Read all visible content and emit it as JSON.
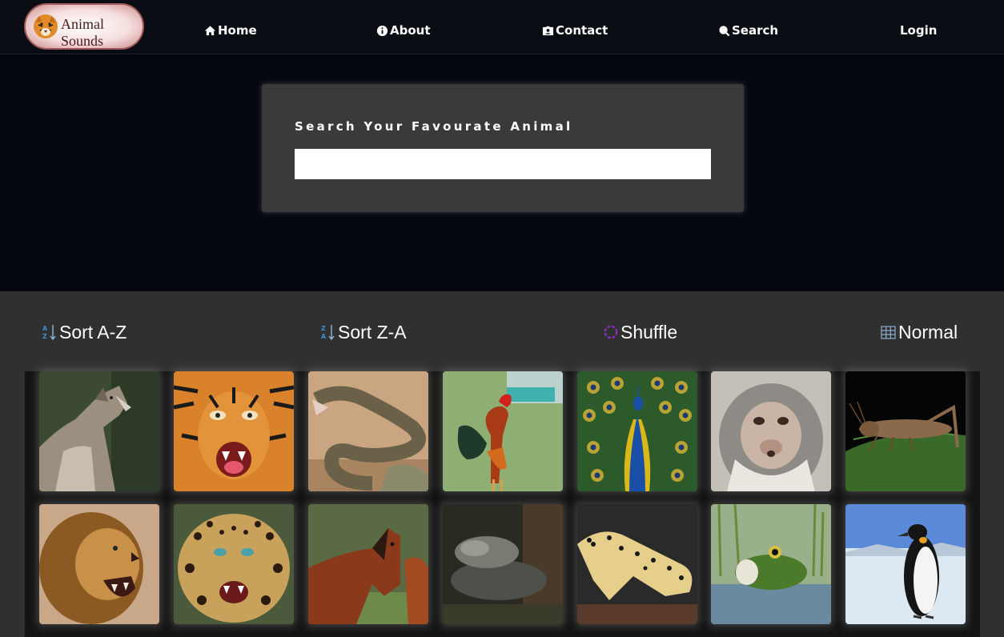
{
  "logo": {
    "text": "Animal Sounds",
    "icon": "tiger-icon"
  },
  "nav": {
    "items": [
      {
        "label": "Home",
        "icon": "home-icon"
      },
      {
        "label": "About",
        "icon": "info-icon"
      },
      {
        "label": "Contact",
        "icon": "contact-card-icon"
      },
      {
        "label": "Search",
        "icon": "search-icon"
      },
      {
        "label": "Login",
        "icon": ""
      }
    ]
  },
  "search": {
    "title": "Search Your Favourate Animal",
    "value": "",
    "placeholder": ""
  },
  "sort": {
    "az_label": "Sort A-Z",
    "za_label": "Sort Z-A",
    "shuffle_label": "Shuffle",
    "normal_label": "Normal"
  },
  "colors": {
    "nav_bg": "#0b0d14",
    "hero_bg": "#05070f",
    "panel_bg": "#303030",
    "card_bg": "#3a3a3a",
    "sort_icon_blue": "#3b8fd8",
    "shuffle_purple": "#8a2fc0"
  },
  "animals": [
    {
      "name": "wolf"
    },
    {
      "name": "tiger"
    },
    {
      "name": "snake"
    },
    {
      "name": "rooster"
    },
    {
      "name": "peacock"
    },
    {
      "name": "monkey"
    },
    {
      "name": "grasshopper"
    },
    {
      "name": "lion"
    },
    {
      "name": "leopard"
    },
    {
      "name": "horse"
    },
    {
      "name": "turtle"
    },
    {
      "name": "gecko"
    },
    {
      "name": "frog"
    },
    {
      "name": "penguin"
    }
  ]
}
